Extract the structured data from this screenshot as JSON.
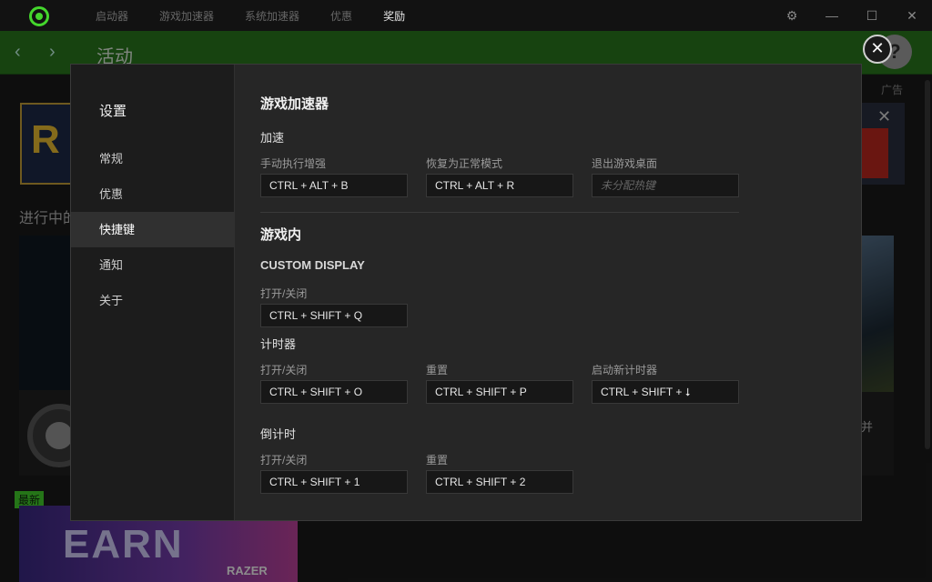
{
  "titlebar": {
    "nav": [
      "启动器",
      "游戏加速器",
      "系统加速器",
      "优惠",
      "奖励"
    ],
    "active_index": 4,
    "settings_icon": "gear-icon",
    "minimize": "—",
    "maximize": "☐",
    "close": "✕"
  },
  "header": {
    "back": "‹",
    "forward": "›",
    "title": "活动"
  },
  "background": {
    "ad_label": "广告",
    "progress_title": "进行中的",
    "right_card_text": "并",
    "new_badge": "最新",
    "earn_text": "EARN",
    "razer_text": "RAZER",
    "left_banner_letter": "R"
  },
  "modal": {
    "sidebar": {
      "heading": "设置",
      "items": [
        "常规",
        "优惠",
        "快捷键",
        "通知",
        "关于"
      ],
      "active_index": 2
    },
    "title": "游戏加速器",
    "boost": {
      "heading": "加速",
      "fields": [
        {
          "label": "手动执行增强",
          "value": "CTRL + ALT + B",
          "placeholder": ""
        },
        {
          "label": "恢复为正常模式",
          "value": "CTRL + ALT + R",
          "placeholder": ""
        },
        {
          "label": "退出游戏桌面",
          "value": "",
          "placeholder": "未分配热键"
        }
      ]
    },
    "ingame": {
      "title": "游戏内",
      "custom_display": {
        "heading": "CUSTOM DISPLAY",
        "fields": [
          {
            "label": "打开/关闭",
            "value": "CTRL + SHIFT + Q"
          }
        ]
      },
      "timer": {
        "heading": "计时器",
        "fields": [
          {
            "label": "打开/关闭",
            "value": "CTRL + SHIFT + O"
          },
          {
            "label": "重置",
            "value": "CTRL + SHIFT + P"
          },
          {
            "label": "启动新计时器",
            "value": "CTRL + SHIFT + ⭣"
          }
        ]
      },
      "countdown": {
        "heading": "倒计时",
        "fields": [
          {
            "label": "打开/关闭",
            "value": "CTRL + SHIFT + 1"
          },
          {
            "label": "重置",
            "value": "CTRL + SHIFT + 2"
          }
        ]
      }
    },
    "close_label": "✕",
    "help_label": "?"
  }
}
